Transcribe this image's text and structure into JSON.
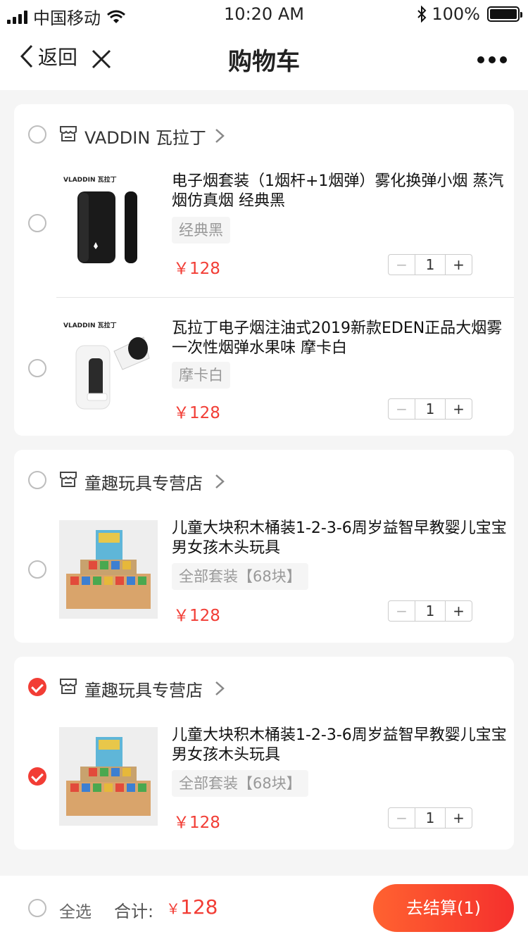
{
  "status_bar": {
    "carrier": "中国移动",
    "time": "10:20 AM",
    "battery": "100%"
  },
  "nav": {
    "back_label": "返回",
    "title": "购物车"
  },
  "stores": [
    {
      "name": "VADDIN 瓦拉丁",
      "checked": false,
      "items": [
        {
          "title": "电子烟套装（1烟杆+1烟弹）雾化换弹小烟 蒸汽烟仿真烟 经典黑",
          "spec": "经典黑",
          "price": "￥128",
          "qty": "1",
          "brand_text": "VLADDIN 瓦拉丁",
          "checked": false
        },
        {
          "title": "瓦拉丁电子烟注油式2019新款EDEN正品大烟雾一次性烟弹水果味 摩卡白",
          "spec": "摩卡白",
          "price": "￥128",
          "qty": "1",
          "brand_text": "VLADDIN 瓦拉丁",
          "checked": false
        }
      ]
    },
    {
      "name": "童趣玩具专营店",
      "checked": false,
      "items": [
        {
          "title": "儿童大块积木桶装1-2-3-6周岁益智早教婴儿宝宝男女孩木头玩具",
          "spec": "全部套装【68块】",
          "price": "￥128",
          "qty": "1",
          "checked": false
        }
      ]
    },
    {
      "name": "童趣玩具专营店",
      "checked": true,
      "items": [
        {
          "title": "儿童大块积木桶装1-2-3-6周岁益智早教婴儿宝宝男女孩木头玩具",
          "spec": "全部套装【68块】",
          "price": "￥128",
          "qty": "1",
          "checked": true
        }
      ]
    }
  ],
  "stepper": {
    "minus": "−",
    "plus": "+"
  },
  "bottom": {
    "select_all": "全选",
    "total_label": "合计:",
    "total_currency": "￥",
    "total_value": "128",
    "checkout_label": "去结算(1)"
  },
  "colors": {
    "accent": "#f23d35",
    "checkout_gradient_start": "#ff6230",
    "checkout_gradient_end": "#f5302d"
  }
}
